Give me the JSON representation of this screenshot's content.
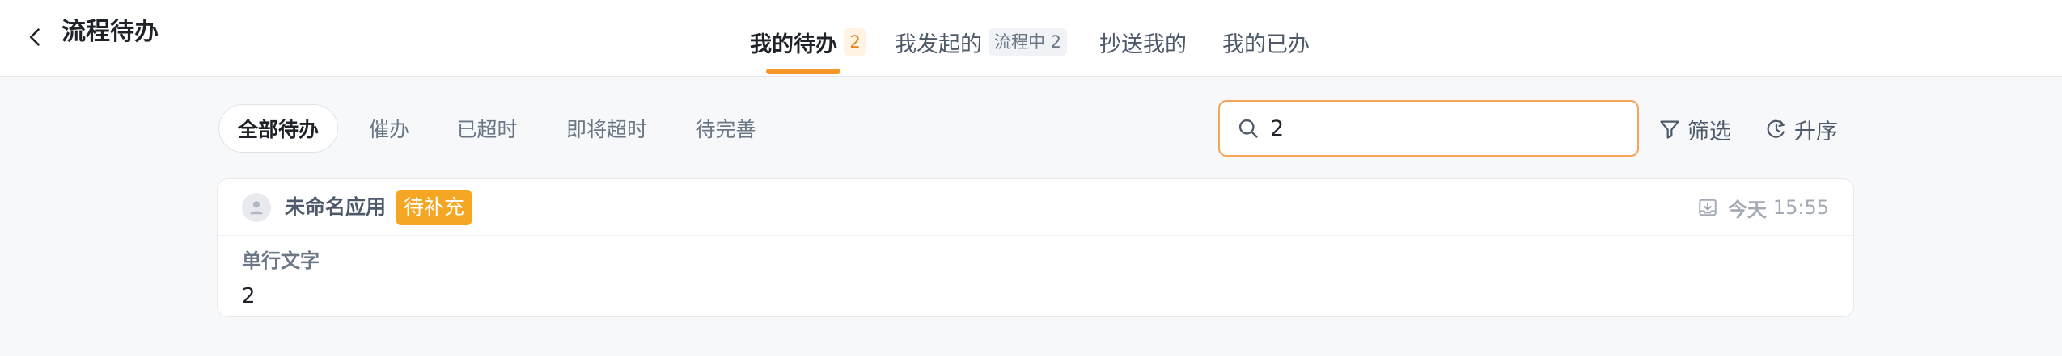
{
  "header": {
    "title": "流程待办",
    "tabs": [
      {
        "label": "我的待办",
        "badge": "2"
      },
      {
        "label": "我发起的",
        "badge": "流程中 2"
      },
      {
        "label": "抄送我的"
      },
      {
        "label": "我的已办"
      }
    ]
  },
  "filters": {
    "chips": [
      "全部待办",
      "催办",
      "已超时",
      "即将超时",
      "待完善"
    ]
  },
  "search": {
    "value": "2"
  },
  "toolbar": {
    "filter_label": "筛选",
    "sort_label": "升序"
  },
  "card": {
    "app_name": "未命名应用",
    "status": "待补充",
    "time_day": "今天",
    "time_value": "15:55",
    "field_label": "单行文字",
    "field_value": "2"
  },
  "colors": {
    "accent": "#f5962a",
    "status_badge": "#f5a623",
    "page_bg": "#f7f8fa"
  },
  "icons": {
    "back": "chevron-left-icon",
    "search": "search-icon",
    "filter": "funnel-icon",
    "sort": "sort-clock-icon",
    "avatar": "user-icon",
    "time": "download-tray-icon"
  }
}
